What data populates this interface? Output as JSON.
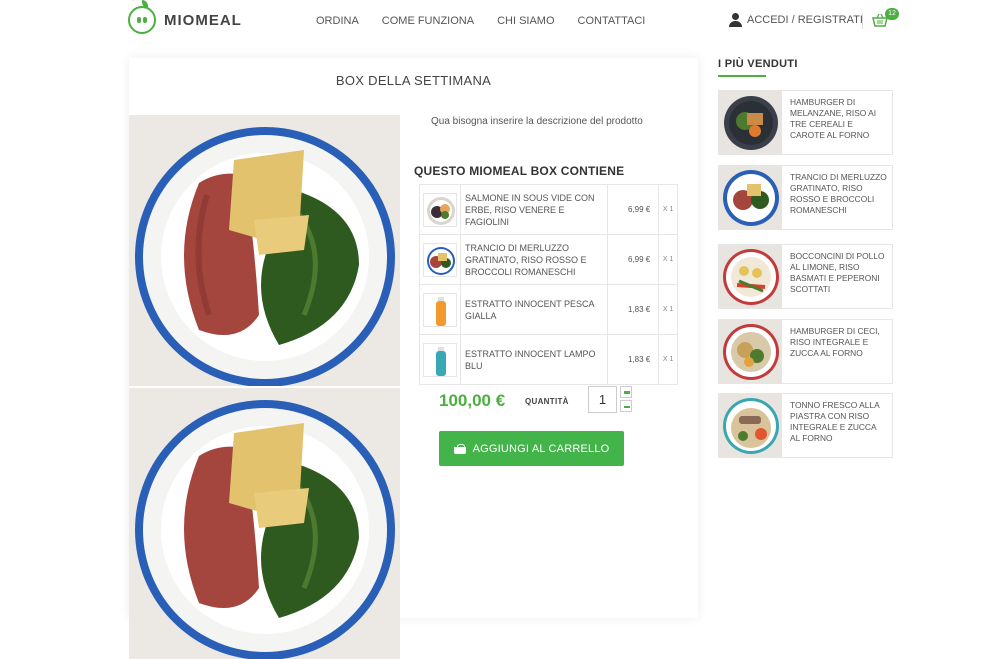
{
  "header": {
    "brand": "MIOMEAL",
    "nav": [
      "ORDINA",
      "COME FUNZIONA",
      "CHI SIAMO",
      "CONTATTACI"
    ],
    "account_label": "ACCEDI / REGISTRATI",
    "cart_count": "12"
  },
  "product": {
    "title": "BOX DELLA SETTIMANA",
    "description": "Qua bisogna inserire la descrizione del prodotto",
    "contains_title": "QUESTO MIOMEAL BOX CONTIENE",
    "items": [
      {
        "name": "SALMONE IN SOUS VIDE CON ERBE, RISO VENERE E FAGIOLINI",
        "price": "6,99 €",
        "qty": "X 1",
        "icon": "plate-salmon-icon"
      },
      {
        "name": "TRANCIO DI MERLUZZO GRATINATO, RISO ROSSO E BROCCOLI ROMANESCHI",
        "price": "6,99 €",
        "qty": "X 1",
        "icon": "plate-cod-icon"
      },
      {
        "name": "ESTRATTO INNOCENT PESCA GIALLA",
        "price": "1,83 €",
        "qty": "X 1",
        "icon": "bottle-orange-icon"
      },
      {
        "name": "ESTRATTO INNOCENT LAMPO BLU",
        "price": "1,83 €",
        "qty": "X 1",
        "icon": "bottle-blue-icon"
      }
    ],
    "price": "100,00 €",
    "quantity_label": "QUANTITÀ",
    "quantity_value": "1",
    "add_to_cart_label": "AGGIUNGI AL CARRELLO"
  },
  "sidebar": {
    "title": "I PIÙ VENDUTI",
    "items": [
      {
        "name": "HAMBURGER DI MELANZANE, RISO AI TRE CEREALI E CAROTE AL FORNO"
      },
      {
        "name": "TRANCIO DI MERLUZZO GRATINATO, RISO ROSSO E BROCCOLI ROMANESCHI"
      },
      {
        "name": "BOCCONCINI DI POLLO AL LIMONE, RISO BASMATI E PEPERONI SCOTTATI"
      },
      {
        "name": "HAMBURGER DI CECI, RISO INTEGRALE E ZUCCA AL FORNO"
      },
      {
        "name": "TONNO FRESCO ALLA PIASTRA CON RISO INTEGRALE E ZUCCA AL FORNO"
      }
    ]
  },
  "colors": {
    "accent": "#4caf3f",
    "button": "#43b449",
    "plate_rim": "#2a5fb8"
  }
}
